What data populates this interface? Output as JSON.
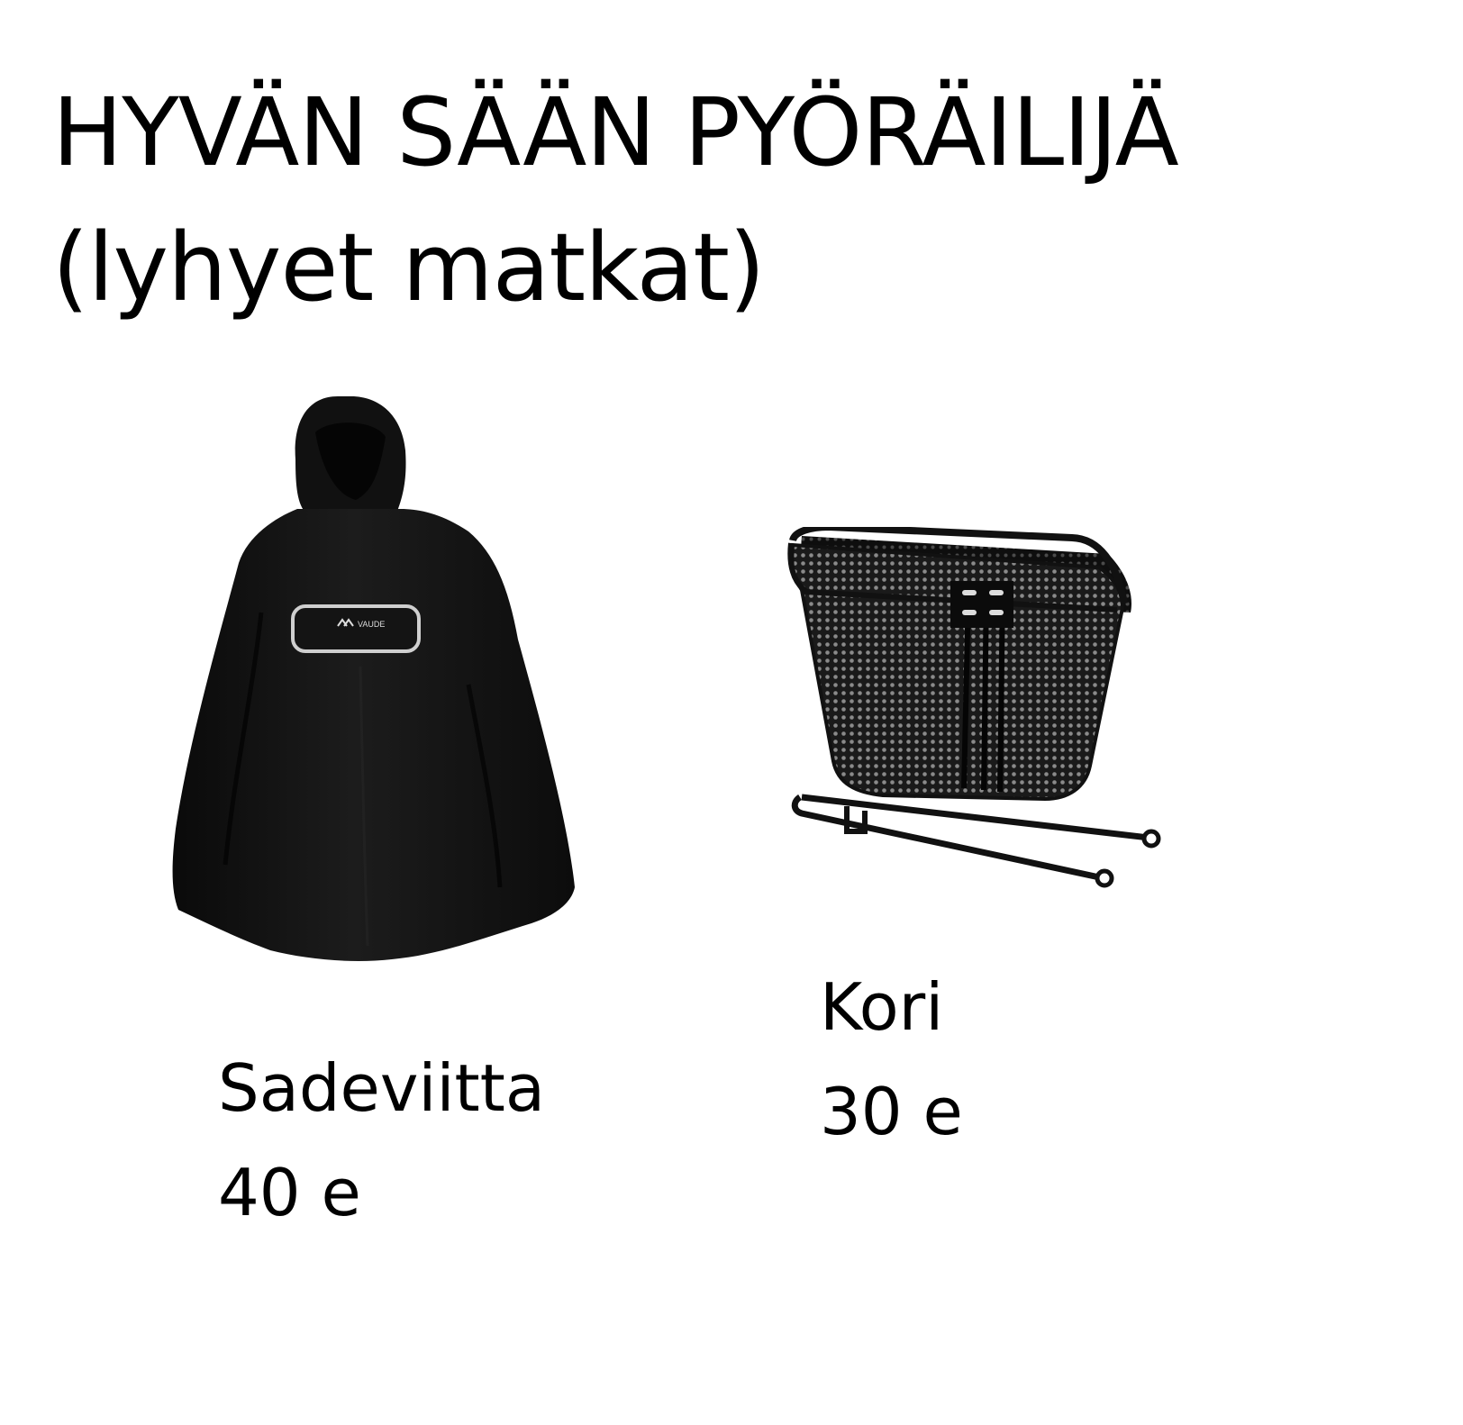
{
  "title": {
    "line1": "HYVÄN SÄÄN PYÖRÄILIJÄ",
    "line2": "(lyhyet matkat)"
  },
  "products": [
    {
      "name": "Sadeviitta",
      "price": "40 e",
      "logo_text": "VAUDE",
      "icon": "rain-poncho-icon"
    },
    {
      "name": "Kori",
      "price": "30 e",
      "icon": "bicycle-basket-icon"
    }
  ],
  "colors": {
    "background": "#ffffff",
    "text": "#000000",
    "product": "#141414"
  }
}
